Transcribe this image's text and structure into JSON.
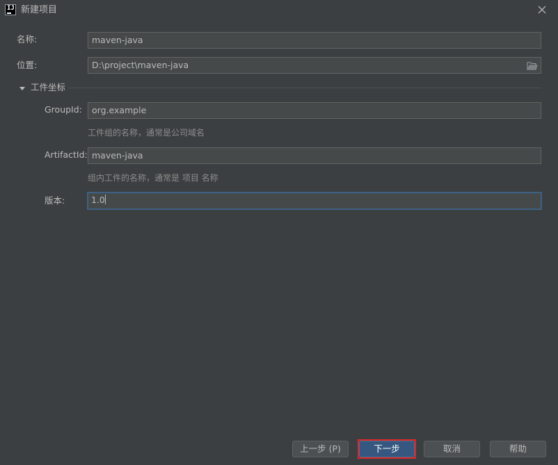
{
  "window": {
    "title": "新建项目"
  },
  "form": {
    "name": {
      "label": "名称:",
      "value": "maven-java"
    },
    "location": {
      "label": "位置:",
      "value": "D:\\project\\maven-java"
    },
    "section": {
      "title": "工件坐标"
    },
    "group_id": {
      "label": "GroupId:",
      "value": "org.example",
      "hint": "工件组的名称，通常是公司域名"
    },
    "artifact_id": {
      "label": "ArtifactId:",
      "value": "maven-java",
      "hint": "组内工件的名称，通常是 项目 名称"
    },
    "version": {
      "label": "版本:",
      "value": "1.0"
    }
  },
  "buttons": {
    "previous": "上一步 (P)",
    "next": "下一步",
    "cancel": "取消",
    "help": "帮助"
  },
  "colors": {
    "background": "#3c3f41",
    "field_background": "#45494a",
    "primary_button": "#365880",
    "highlight": "#e0262b"
  },
  "icons": {
    "app": "intellij-idea-icon",
    "close": "close-icon",
    "browse": "folder-icon",
    "toggle": "triangle-down-icon"
  }
}
